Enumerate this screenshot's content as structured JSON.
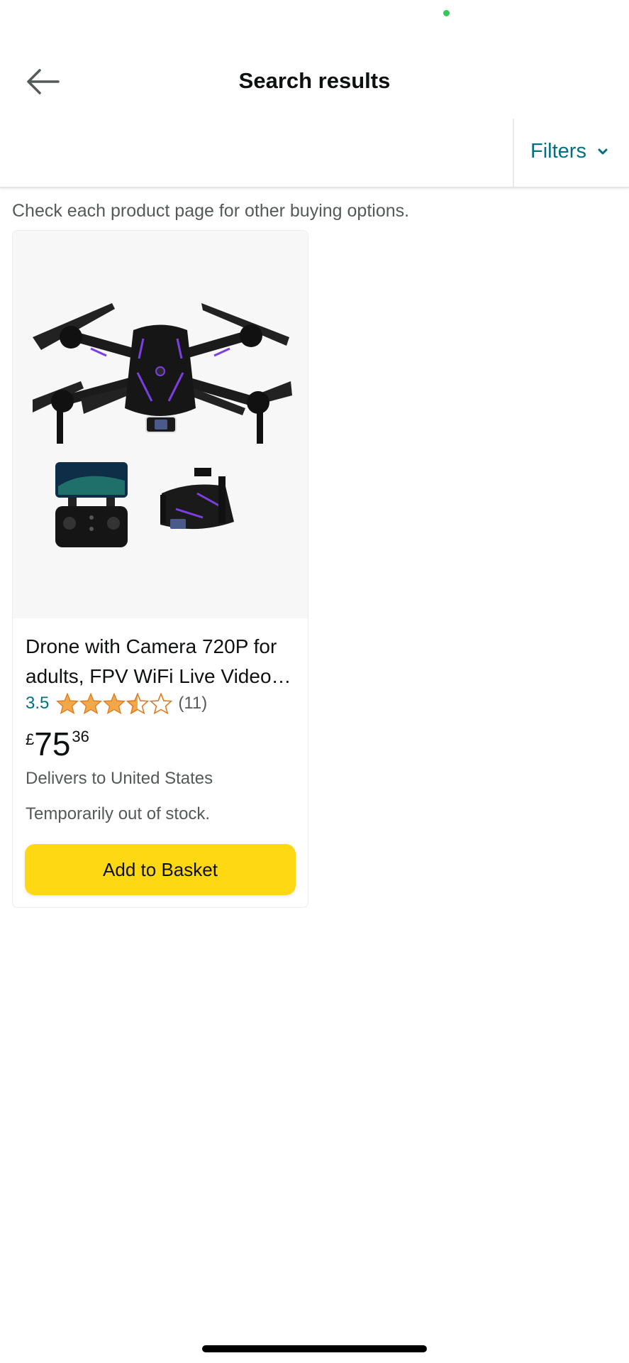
{
  "colors": {
    "status_dot": "#34c759",
    "link_teal": "#007185",
    "star_orange": "#f3a847",
    "button_yellow": "#ffd814"
  },
  "header": {
    "back_icon": "arrow-left-icon",
    "title": "Search results"
  },
  "filter_bar": {
    "filters_label": "Filters",
    "chevron_icon": "chevron-down-icon"
  },
  "notice": "Check each product page for other buying options.",
  "product": {
    "image_icon": "drone-product-image",
    "title_line1": "Drone with Camera 720P for",
    "title_line2": "adults, FPV WiFi Live Video…",
    "rating": "3.5",
    "rating_value": 3.5,
    "rating_max": 5,
    "review_count": "(11)",
    "price_symbol": "£",
    "price_whole": "75",
    "price_fraction": "36",
    "delivery": "Delivers to United States",
    "stock_status": "Temporarily out of stock.",
    "add_button": "Add to Basket"
  }
}
